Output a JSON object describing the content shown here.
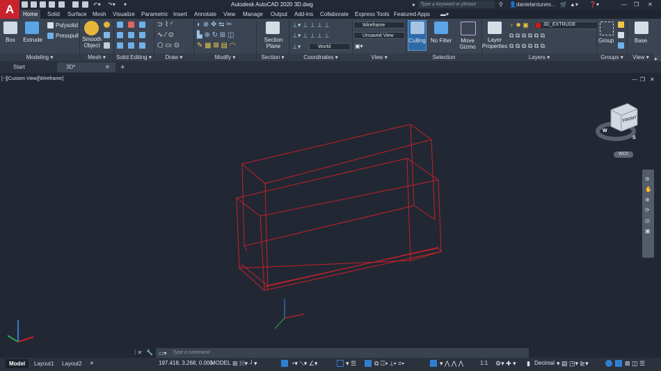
{
  "titlebar": {
    "app_logo": "A",
    "title": "Autodesk AutoCAD 2020    3D.dwg",
    "search_placeholder": "Type a keyword or phrase",
    "user": "danielantunes..."
  },
  "ribbon_tabs": [
    "Home",
    "Solid",
    "Surface",
    "Mesh",
    "Visualize",
    "Parametric",
    "Insert",
    "Annotate",
    "View",
    "Manage",
    "Output",
    "Add-ins",
    "Collaborate",
    "Express Tools",
    "Featured Apps"
  ],
  "ribbon": {
    "modeling": {
      "box": "Box",
      "extrude": "Extrude",
      "polysolid": "Polysolid",
      "presspull": "Presspull",
      "label": "Modeling"
    },
    "mesh": {
      "smooth": "Smooth Object",
      "label": "Mesh"
    },
    "solid_editing": {
      "label": "Solid Editing"
    },
    "draw": {
      "label": "Draw"
    },
    "modify": {
      "label": "Modify"
    },
    "section": {
      "plane": "Section Plane",
      "label": "Section"
    },
    "coordinates": {
      "world": "World",
      "label": "Coordinates"
    },
    "view": {
      "style": "Wireframe",
      "saved": "Unsaved View",
      "label": "View"
    },
    "selection": {
      "culling": "Culling",
      "filter": "No Filter",
      "gizmo": "Move Gizmo",
      "label": "Selection"
    },
    "layers": {
      "props": "Layer Properties",
      "current": "3D_EXTRUDE",
      "label": "Layers"
    },
    "groups": {
      "group": "Group",
      "label": "Groups"
    },
    "view2": {
      "base": "Base",
      "label": "View"
    }
  },
  "doc_tabs": {
    "start": "Start",
    "active": "3D*"
  },
  "viewport": {
    "label": "[−][Custom View][Wireframe]",
    "cube_face": "FRONT",
    "wcs": "WCS",
    "compass_w": "W",
    "compass_s": "S"
  },
  "command": {
    "placeholder": "Type a command"
  },
  "layout_tabs": [
    "Model",
    "Layout1",
    "Layout2"
  ],
  "status": {
    "coords": "197.418, 3.268, 0.000",
    "model": "MODEL",
    "scale": "1:1",
    "units": "Decimal"
  },
  "colors": {
    "accent": "#2f7fd1",
    "wire": "#c8202a",
    "logo": "#c8232c"
  }
}
